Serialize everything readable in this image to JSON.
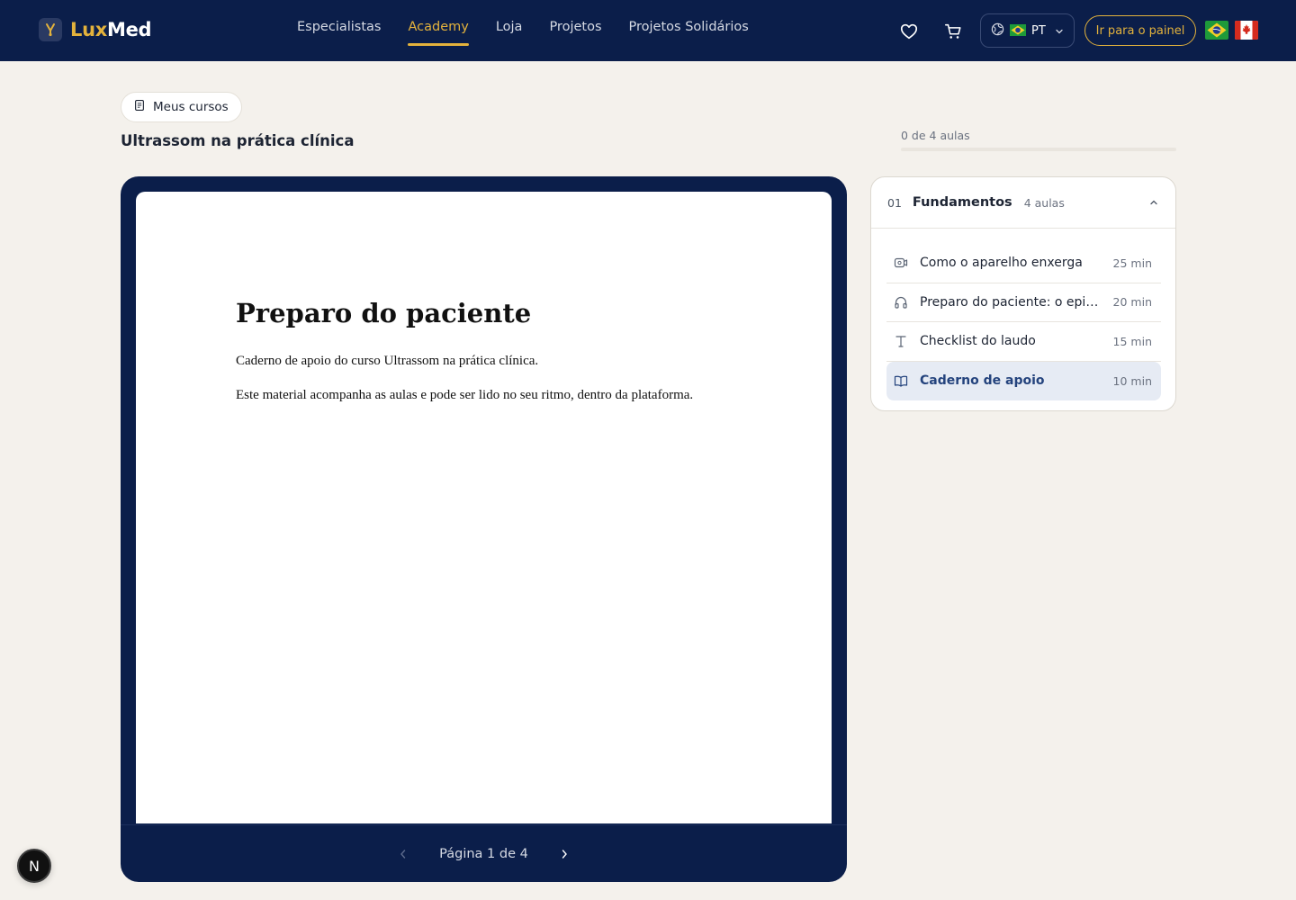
{
  "brand": {
    "part1": "Lux",
    "part2": "Med",
    "accent": "#e3b23c",
    "navy": "#0b1e4a"
  },
  "nav": {
    "items": [
      {
        "label": "Especialistas",
        "active": false
      },
      {
        "label": "Academy",
        "active": true
      },
      {
        "label": "Loja",
        "active": false
      },
      {
        "label": "Projetos",
        "active": false
      },
      {
        "label": "Projetos Solidários",
        "active": false
      }
    ]
  },
  "header": {
    "favorites_icon": "heart-icon",
    "cart_icon": "cart-icon",
    "language": {
      "code": "PT",
      "icon": "globe-icon",
      "flag": "brazil-flag-icon"
    },
    "panel_label": "Ir para o painel",
    "flags": [
      "brazil-flag-icon",
      "canada-flag-icon"
    ]
  },
  "breadcrumb": {
    "my_courses": "Meus cursos"
  },
  "course": {
    "title": "Ultrassom na prática clínica",
    "progress_label": "0 de 4 aulas",
    "progress_fraction": 0
  },
  "reader": {
    "doc_title": "Preparo do paciente",
    "paragraphs": [
      "Caderno de apoio do curso Ultrassom na prática clínica.",
      "Este material acompanha as aulas e pode ser lido no seu ritmo, dentro da plataforma."
    ],
    "page_label": "Página 1 de 4"
  },
  "module": {
    "number": "01",
    "name": "Fundamentos",
    "count": "4 aulas",
    "lessons": [
      {
        "icon": "video-icon",
        "title": "Como o aparelho enxerga",
        "duration": "25 min",
        "active": false
      },
      {
        "icon": "headphones-icon",
        "title": "Preparo do paciente: o epis...",
        "duration": "20 min",
        "active": false
      },
      {
        "icon": "text-icon",
        "title": "Checklist do laudo",
        "duration": "15 min",
        "active": false
      },
      {
        "icon": "book-icon",
        "title": "Caderno de apoio",
        "duration": "10 min",
        "active": true
      }
    ]
  },
  "badge": {
    "letter": "N"
  }
}
